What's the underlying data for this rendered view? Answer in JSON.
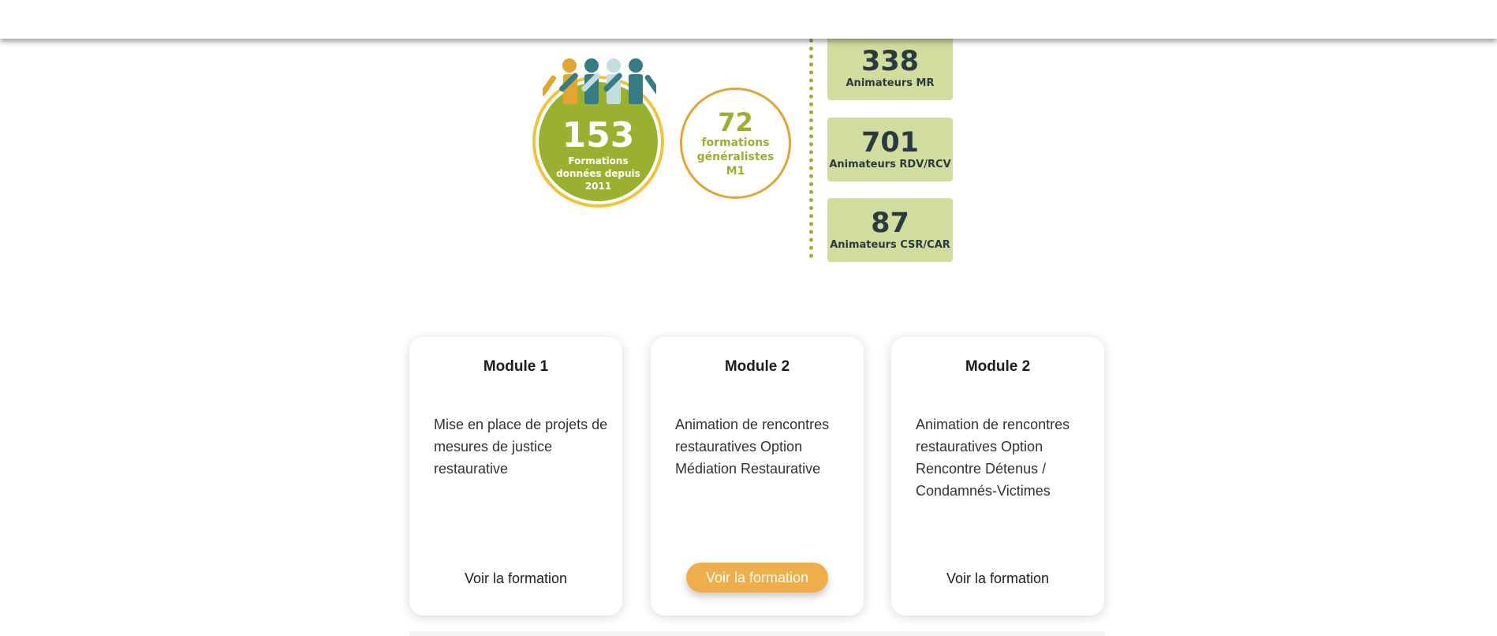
{
  "stats": {
    "total": {
      "number": "153",
      "caption": "Formations données depuis 2011"
    },
    "generalist": {
      "number": "72",
      "caption": "formations généralistes M1"
    },
    "boxes": [
      {
        "number": "338",
        "label": "Animateurs MR"
      },
      {
        "number": "701",
        "label": "Animateurs RDV/RCV"
      },
      {
        "number": "87",
        "label": "Animateurs CSR/CAR"
      }
    ]
  },
  "modules": [
    {
      "title": "Module 1",
      "description": "Mise en place de projets de mesures de justice restaurative",
      "link": "Voir la formation"
    },
    {
      "title": "Module 2",
      "description": "Animation de rencontres restauratives Option Médiation Restaurative",
      "link": "Voir la formation"
    },
    {
      "title": "Module 2",
      "description": "Animation de rencontres restauratives Option Rencontre Détenus / Condamnés-Victimes",
      "link": "Voir la formation"
    }
  ],
  "colors": {
    "green": "#99b12e",
    "yellow": "#f2c23a",
    "orange": "#e2a52e",
    "teal": "#357c84",
    "light_teal": "#c3dde0",
    "box_green": "#d1dc9f",
    "button": "#f0ae4b"
  }
}
